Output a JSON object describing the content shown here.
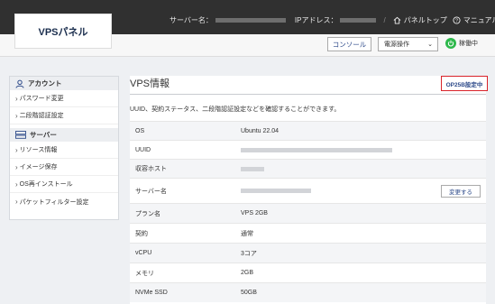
{
  "app": {
    "logo": "VPSパネル"
  },
  "header": {
    "server_name_label": "サーバー名：",
    "ip_label": "IPアドレス：",
    "separator": "/",
    "panel_top": "パネルトップ",
    "manual": "マニュアル"
  },
  "toolbar": {
    "console": "コンソール",
    "power_select": "電源操作",
    "status": "稼働中",
    "status_color": "#2db84b"
  },
  "sidebar": {
    "account_title": "アカウント",
    "account_items": [
      {
        "label": "パスワード変更"
      },
      {
        "label": "二段階認証設定"
      }
    ],
    "server_title": "サーバー",
    "server_items": [
      {
        "label": "リソース情報"
      },
      {
        "label": "イメージ保存"
      },
      {
        "label": "OS再インストール"
      },
      {
        "label": "パケットフィルター設定"
      }
    ]
  },
  "main": {
    "title": "VPS情報",
    "op25b": "OP25B設定中",
    "description": "UUID、契約ステータス、二段階認証設定などを確認することができます。",
    "change_button": "変更する",
    "rows": [
      {
        "key": "OS",
        "value": "Ubuntu 22.04"
      },
      {
        "key": "UUID",
        "value": ""
      },
      {
        "key": "収容ホスト",
        "value": ""
      },
      {
        "key": "サーバー名",
        "value": ""
      },
      {
        "key": "プラン名",
        "value": "VPS 2GB"
      },
      {
        "key": "契約",
        "value": "通常"
      },
      {
        "key": "vCPU",
        "value": "3コア"
      },
      {
        "key": "メモリ",
        "value": "2GB"
      },
      {
        "key": "NVMe SSD",
        "value": "50GB"
      }
    ]
  }
}
